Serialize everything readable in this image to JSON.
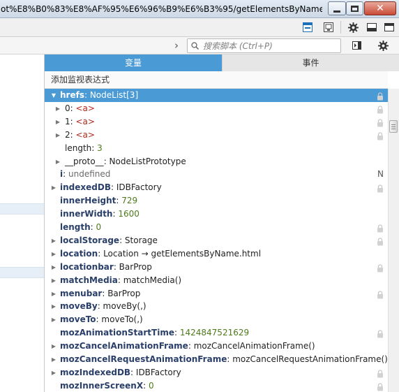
{
  "window": {
    "title": "ot%E8%B0%83%E8%AF%95%E6%96%B9%E6%B3%95/getElementsByName.ht...",
    "close_glyph": "✕"
  },
  "toolbar": {
    "icons": [
      "console-layout-icon",
      "screenshot-icon",
      "gear-icon",
      "dock-bottom-icon",
      "dock-side-icon"
    ]
  },
  "search": {
    "placeholder": "搜索脚本 (Ctrl+P)",
    "value": ""
  },
  "tabs": {
    "variables": "变量",
    "events": "事件"
  },
  "watch": {
    "add_label": "添加监视表达式"
  },
  "colors": {
    "accent": "#4a9ad6",
    "number": "#4f7a1c",
    "tag": "#b0281a"
  },
  "variables": [
    {
      "name": "hrefs",
      "sep": ": ",
      "value": "NodeList[3]",
      "vtype": "v",
      "expand": "open",
      "indent": 0,
      "header": true,
      "lock": true,
      "bold": true
    },
    {
      "name": "0",
      "sep": ": ",
      "value": "<a>",
      "vtype": "vtag",
      "expand": "closed",
      "indent": 1,
      "lock": true,
      "bold": false
    },
    {
      "name": "1",
      "sep": ": ",
      "value": "<a>",
      "vtype": "vtag",
      "expand": "closed",
      "indent": 1,
      "lock": true,
      "bold": false
    },
    {
      "name": "2",
      "sep": ": ",
      "value": "<a>",
      "vtype": "vtag",
      "expand": "closed",
      "indent": 1,
      "lock": true,
      "bold": false
    },
    {
      "name": "length",
      "sep": ": ",
      "value": "3",
      "vtype": "vnum",
      "expand": "none",
      "indent": 1,
      "lock": false,
      "bold": false
    },
    {
      "name": "__proto__",
      "sep": ": ",
      "value": "NodeListPrototype",
      "vtype": "v",
      "expand": "closed",
      "indent": 1,
      "lock": false,
      "bold": false
    },
    {
      "name": "i",
      "sep": ": ",
      "value": "undefined",
      "vtype": "vund",
      "expand": "none",
      "indent": 0,
      "lock": false,
      "bold": true,
      "flag": "N"
    },
    {
      "name": "indexedDB",
      "sep": ": ",
      "value": "IDBFactory",
      "vtype": "v",
      "expand": "closed",
      "indent": 0,
      "lock": true,
      "bold": true
    },
    {
      "name": "innerHeight",
      "sep": ": ",
      "value": "729",
      "vtype": "vnum",
      "expand": "none",
      "indent": 0,
      "lock": false,
      "bold": true
    },
    {
      "name": "innerWidth",
      "sep": ": ",
      "value": "1600",
      "vtype": "vnum",
      "expand": "none",
      "indent": 0,
      "lock": false,
      "bold": true
    },
    {
      "name": "length",
      "sep": ": ",
      "value": "0",
      "vtype": "vnum",
      "expand": "none",
      "indent": 0,
      "lock": true,
      "bold": true
    },
    {
      "name": "localStorage",
      "sep": ": ",
      "value": "Storage",
      "vtype": "v",
      "expand": "closed",
      "indent": 0,
      "lock": true,
      "bold": true
    },
    {
      "name": "location",
      "sep": ": ",
      "value": "Location → getElementsByName.html",
      "vtype": "v",
      "expand": "closed",
      "indent": 0,
      "lock": false,
      "bold": true
    },
    {
      "name": "locationbar",
      "sep": ": ",
      "value": "BarProp",
      "vtype": "v",
      "expand": "closed",
      "indent": 0,
      "lock": true,
      "bold": true
    },
    {
      "name": "matchMedia",
      "sep": ": ",
      "value": "matchMedia()",
      "vtype": "v",
      "expand": "closed",
      "indent": 0,
      "lock": false,
      "bold": true
    },
    {
      "name": "menubar",
      "sep": ": ",
      "value": "BarProp",
      "vtype": "v",
      "expand": "closed",
      "indent": 0,
      "lock": true,
      "bold": true
    },
    {
      "name": "moveBy",
      "sep": ": ",
      "value": "moveBy(,)",
      "vtype": "v",
      "expand": "closed",
      "indent": 0,
      "lock": false,
      "bold": true
    },
    {
      "name": "moveTo",
      "sep": ": ",
      "value": "moveTo(,)",
      "vtype": "v",
      "expand": "closed",
      "indent": 0,
      "lock": false,
      "bold": true
    },
    {
      "name": "mozAnimationStartTime",
      "sep": ": ",
      "value": "1424847521629",
      "vtype": "vnum",
      "expand": "none",
      "indent": 0,
      "lock": true,
      "bold": true
    },
    {
      "name": "mozCancelAnimationFrame",
      "sep": ": ",
      "value": "mozCancelAnimationFrame()",
      "vtype": "v",
      "expand": "closed",
      "indent": 0,
      "lock": false,
      "bold": true
    },
    {
      "name": "mozCancelRequestAnimationFrame",
      "sep": ": ",
      "value": "mozCancelRequestAnimationFrame()",
      "vtype": "v",
      "expand": "closed",
      "indent": 0,
      "lock": false,
      "bold": true
    },
    {
      "name": "mozIndexedDB",
      "sep": ": ",
      "value": "IDBFactory",
      "vtype": "v",
      "expand": "closed",
      "indent": 0,
      "lock": true,
      "bold": true
    },
    {
      "name": "mozInnerScreenX",
      "sep": ": ",
      "value": "0",
      "vtype": "vnum",
      "expand": "none",
      "indent": 0,
      "lock": true,
      "bold": true
    }
  ]
}
